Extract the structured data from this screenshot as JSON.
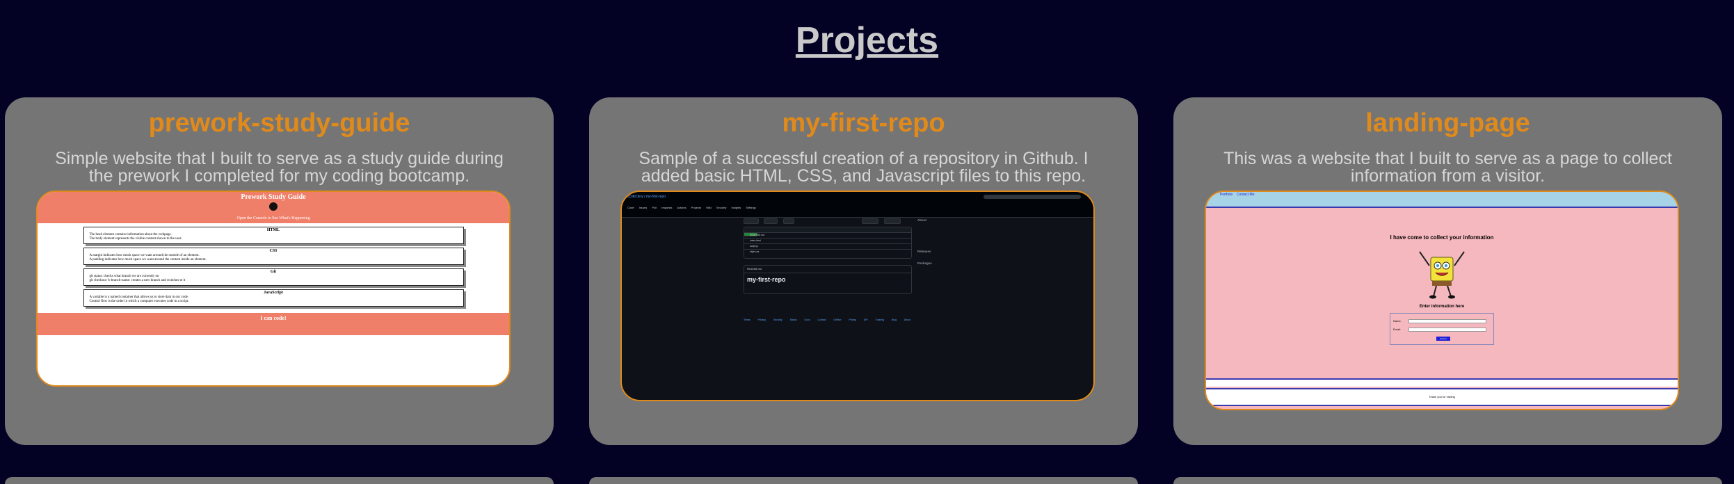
{
  "page": {
    "title": "Projects"
  },
  "cards": [
    {
      "title": "prework-study-guide",
      "description": "Simple website that I built to serve as a study guide during the prework I completed for my coding bootcamp.",
      "preview": {
        "header": "Prework Study Guide",
        "banner": "Open the Console to See What's Happening",
        "topics": [
          {
            "name": "HTML",
            "notes": [
              "The head element contains information about the webpage.",
              "The body element represents the visible content shown to the user."
            ]
          },
          {
            "name": "CSS",
            "notes": [
              "A margin indicates how much space we want around the outside of an element.",
              "A padding indicates how much space we want around the content inside an element."
            ]
          },
          {
            "name": "Git",
            "notes": [
              "git status: checks what branch we are currently on",
              "git checkout -b branch-name: creates a new branch and switches to it"
            ]
          },
          {
            "name": "JavaScript",
            "notes": [
              "A variable is a named container that allows us to store data in our code.",
              "Control flow is the order in which a computer executes code in a script."
            ]
          }
        ],
        "footer": "I can code!"
      }
    },
    {
      "title": "my-first-repo",
      "description": "Sample of a successful creation of a repository in Github. I added basic HTML, CSS, and Javascript files to this repo.",
      "preview": {
        "breadcrumb": "scottrclery / my-first-repo",
        "tabs": [
          "Code",
          "Issues",
          "Pull requests",
          "Actions",
          "Projects",
          "Wiki",
          "Security",
          "Insights",
          "Settings"
        ],
        "files": [
          "README.md",
          "index.html",
          "script.js",
          "style.css"
        ],
        "readme_label": "README.md",
        "readme_heading": "my-first-repo",
        "about": "About",
        "releases": "Releases",
        "packages": "Packages",
        "footer_links": [
          "Terms",
          "Privacy",
          "Security",
          "Status",
          "Docs",
          "Contact GitHub",
          "Pricing",
          "API",
          "Training",
          "Blog",
          "About"
        ]
      }
    },
    {
      "title": "landing-page",
      "description": "This was a website that I built to serve as a page to collect information from a visitor.",
      "preview": {
        "nav": [
          "Portfolio",
          "Contact Me"
        ],
        "heading": "I have come to collect your information",
        "subheading": "Enter information here",
        "fields": [
          "Name:",
          "Email:"
        ],
        "submit": "Submit",
        "footer": "Thank you for visiting"
      }
    }
  ]
}
